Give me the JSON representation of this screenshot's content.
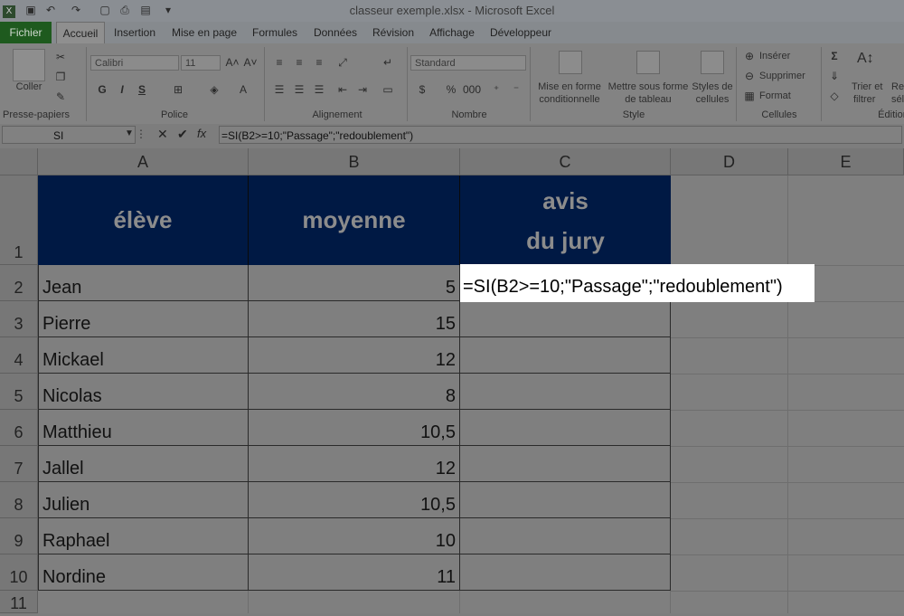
{
  "window": {
    "title": "classeur exemple.xlsx - Microsoft Excel"
  },
  "tabs": [
    "Fichier",
    "Accueil",
    "Insertion",
    "Mise en page",
    "Formules",
    "Données",
    "Révision",
    "Affichage",
    "Développeur"
  ],
  "ribbon": {
    "presse_papiers": {
      "label": "Presse-papiers",
      "coller": "Coller"
    },
    "police": {
      "label": "Police",
      "font": "Calibri",
      "size": "11",
      "bold": "G",
      "italic": "I",
      "underline": "S"
    },
    "alignement": {
      "label": "Alignement"
    },
    "nombre": {
      "label": "Nombre",
      "format": "Standard"
    },
    "style": {
      "label": "Style",
      "cond_line1": "Mise en forme",
      "cond_line2": "conditionnelle",
      "table_line1": "Mettre sous forme",
      "table_line2": "de tableau",
      "styles_line1": "Styles de",
      "styles_line2": "cellules"
    },
    "cellules": {
      "label": "Cellules",
      "inserer": "Insérer",
      "supprimer": "Supprimer",
      "format": "Format"
    },
    "edition": {
      "label": "Édition",
      "trier_line1": "Trier et",
      "trier_line2": "filtrer",
      "rech_line1": "Rec",
      "rech_line2": "sél"
    }
  },
  "formula_bar": {
    "name_box": "SI",
    "fx": "fx",
    "formula": "=SI(B2>=10;\"Passage\";\"redoublement\")"
  },
  "columns": [
    "A",
    "B",
    "C",
    "D",
    "E"
  ],
  "rows": [
    "1",
    "2",
    "3",
    "4",
    "5",
    "6",
    "7",
    "8",
    "9",
    "10",
    "11"
  ],
  "table": {
    "headers": {
      "eleve": "élève",
      "moyenne": "moyenne",
      "avis_line1": "avis",
      "avis_line2": "du jury"
    },
    "students": [
      {
        "name": "Jean",
        "avg": "5"
      },
      {
        "name": "Pierre",
        "avg": "15"
      },
      {
        "name": "Mickael",
        "avg": "12"
      },
      {
        "name": "Nicolas",
        "avg": "8"
      },
      {
        "name": "Matthieu",
        "avg": "10,5"
      },
      {
        "name": "Jallel",
        "avg": "12"
      },
      {
        "name": "Julien",
        "avg": "10,5"
      },
      {
        "name": "Raphael",
        "avg": "10"
      },
      {
        "name": "Nordine",
        "avg": "11"
      }
    ],
    "editing_cell": "=SI(B2>=10;\"Passage\";\"redoublement\")"
  },
  "colors": {
    "header_fill": "#001944",
    "header_text": "#8c8c8c",
    "dim_overlay": "#7f7f7f",
    "edit_cell": "#ffffff"
  }
}
